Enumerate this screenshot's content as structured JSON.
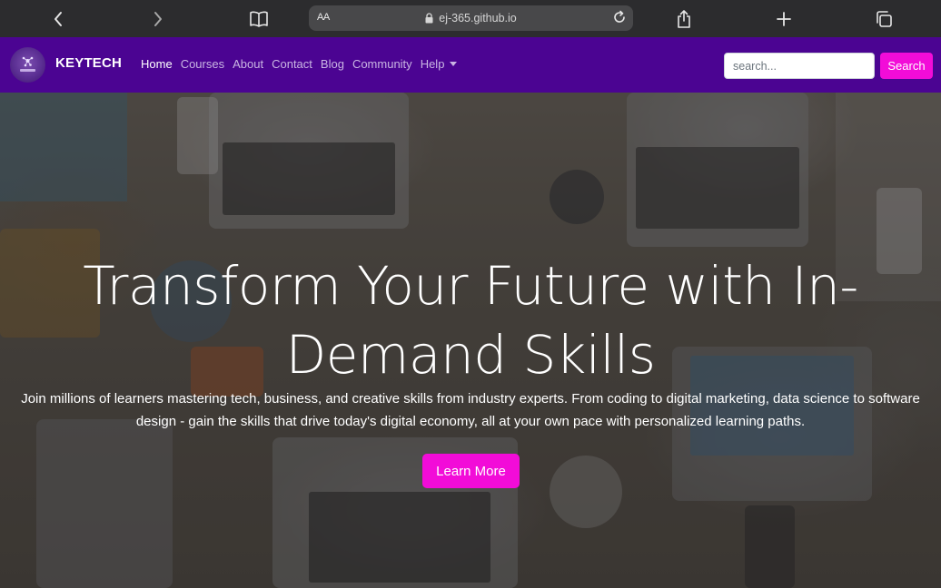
{
  "browser": {
    "url_text": "ej-365.github.io",
    "text_size_label": "AA",
    "icons": [
      "back-icon",
      "forward-icon",
      "bookmarks-icon",
      "lock-icon",
      "reload-icon",
      "share-icon",
      "new-tab-icon",
      "tabs-icon"
    ]
  },
  "navbar": {
    "brand": "KEYTECH",
    "links": [
      {
        "label": "Home",
        "active": true
      },
      {
        "label": "Courses"
      },
      {
        "label": "About"
      },
      {
        "label": "Contact"
      },
      {
        "label": "Blog"
      },
      {
        "label": "Community"
      },
      {
        "label": "Help",
        "dropdown": true
      }
    ],
    "search": {
      "placeholder": "search...",
      "value": "",
      "button": "Search"
    },
    "colors": {
      "background": "#4b0492",
      "accent": "#f20cd8"
    }
  },
  "hero": {
    "title": "Transform Your Future with In-Demand Skills",
    "subtitle": "Join millions of learners mastering tech, business, and creative skills from industry experts. From coding to digital marketing, data science to software design - gain the skills that drive today's digital economy, all at your own pace with personalized learning paths.",
    "button": "Learn More"
  }
}
